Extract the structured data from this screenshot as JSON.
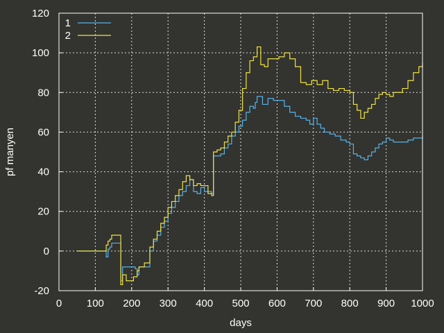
{
  "chart_data": {
    "type": "line",
    "title": "",
    "xlabel": "days",
    "ylabel": "pf manyen",
    "xlim": [
      0,
      1000
    ],
    "ylim": [
      -20,
      120
    ],
    "xticks": [
      0,
      100,
      200,
      300,
      400,
      500,
      600,
      700,
      800,
      900,
      1000
    ],
    "yticks": [
      -20,
      0,
      20,
      40,
      60,
      80,
      100,
      120
    ],
    "grid": true,
    "legend_position": "top-left",
    "background": "#333330",
    "series": [
      {
        "name": "1",
        "color": "#56b4e9",
        "step": true,
        "points": [
          [
            50,
            0
          ],
          [
            128,
            0
          ],
          [
            130,
            -3
          ],
          [
            135,
            1
          ],
          [
            140,
            2
          ],
          [
            145,
            4
          ],
          [
            160,
            4
          ],
          [
            170,
            -15
          ],
          [
            175,
            -8
          ],
          [
            200,
            -8
          ],
          [
            210,
            -9
          ],
          [
            215,
            -12
          ],
          [
            220,
            -8
          ],
          [
            240,
            -8
          ],
          [
            250,
            0
          ],
          [
            260,
            5
          ],
          [
            270,
            8
          ],
          [
            280,
            12
          ],
          [
            290,
            15
          ],
          [
            300,
            19
          ],
          [
            310,
            22
          ],
          [
            320,
            25
          ],
          [
            330,
            28
          ],
          [
            340,
            30
          ],
          [
            350,
            33
          ],
          [
            360,
            36
          ],
          [
            370,
            30
          ],
          [
            380,
            29
          ],
          [
            390,
            32
          ],
          [
            400,
            30
          ],
          [
            410,
            30
          ],
          [
            420,
            29
          ],
          [
            425,
            48
          ],
          [
            435,
            48
          ],
          [
            445,
            49
          ],
          [
            455,
            52
          ],
          [
            465,
            54
          ],
          [
            475,
            58
          ],
          [
            485,
            60
          ],
          [
            495,
            63
          ],
          [
            505,
            66
          ],
          [
            515,
            70
          ],
          [
            525,
            73
          ],
          [
            535,
            72
          ],
          [
            540,
            75
          ],
          [
            545,
            78
          ],
          [
            560,
            74
          ],
          [
            575,
            77
          ],
          [
            590,
            76
          ],
          [
            600,
            76
          ],
          [
            620,
            73
          ],
          [
            635,
            70
          ],
          [
            650,
            68
          ],
          [
            665,
            67
          ],
          [
            680,
            66
          ],
          [
            690,
            64
          ],
          [
            700,
            67
          ],
          [
            710,
            64
          ],
          [
            720,
            62
          ],
          [
            730,
            60
          ],
          [
            745,
            59
          ],
          [
            760,
            58
          ],
          [
            775,
            56
          ],
          [
            790,
            55
          ],
          [
            800,
            54
          ],
          [
            810,
            49
          ],
          [
            820,
            48
          ],
          [
            830,
            47
          ],
          [
            840,
            46
          ],
          [
            850,
            48
          ],
          [
            860,
            50
          ],
          [
            870,
            52
          ],
          [
            880,
            54
          ],
          [
            890,
            55
          ],
          [
            900,
            57
          ],
          [
            910,
            56
          ],
          [
            920,
            55
          ],
          [
            930,
            55
          ],
          [
            945,
            55
          ],
          [
            960,
            56
          ],
          [
            975,
            57
          ],
          [
            990,
            57
          ],
          [
            1000,
            58
          ]
        ]
      },
      {
        "name": "2",
        "color": "#f0e442",
        "step": true,
        "points": [
          [
            50,
            0
          ],
          [
            128,
            0
          ],
          [
            130,
            3
          ],
          [
            135,
            5
          ],
          [
            140,
            6
          ],
          [
            145,
            8
          ],
          [
            160,
            8
          ],
          [
            170,
            -17
          ],
          [
            175,
            -12
          ],
          [
            185,
            -15
          ],
          [
            195,
            -15
          ],
          [
            205,
            -13
          ],
          [
            215,
            -10
          ],
          [
            220,
            -8
          ],
          [
            235,
            -6
          ],
          [
            250,
            2
          ],
          [
            260,
            6
          ],
          [
            270,
            10
          ],
          [
            280,
            14
          ],
          [
            290,
            17
          ],
          [
            300,
            22
          ],
          [
            310,
            25
          ],
          [
            320,
            28
          ],
          [
            330,
            31
          ],
          [
            340,
            35
          ],
          [
            350,
            38
          ],
          [
            360,
            36
          ],
          [
            370,
            33
          ],
          [
            380,
            34
          ],
          [
            390,
            33
          ],
          [
            400,
            33
          ],
          [
            410,
            29
          ],
          [
            420,
            28
          ],
          [
            425,
            50
          ],
          [
            435,
            51
          ],
          [
            445,
            52
          ],
          [
            455,
            55
          ],
          [
            465,
            58
          ],
          [
            475,
            60
          ],
          [
            485,
            65
          ],
          [
            495,
            71
          ],
          [
            505,
            82
          ],
          [
            515,
            90
          ],
          [
            525,
            96
          ],
          [
            535,
            98
          ],
          [
            545,
            103
          ],
          [
            555,
            94
          ],
          [
            565,
            93
          ],
          [
            575,
            97
          ],
          [
            590,
            97
          ],
          [
            605,
            98
          ],
          [
            620,
            100
          ],
          [
            635,
            97
          ],
          [
            650,
            93
          ],
          [
            665,
            85
          ],
          [
            680,
            84
          ],
          [
            695,
            86
          ],
          [
            710,
            84
          ],
          [
            725,
            86
          ],
          [
            740,
            82
          ],
          [
            755,
            81
          ],
          [
            770,
            82
          ],
          [
            785,
            81
          ],
          [
            800,
            80
          ],
          [
            810,
            74
          ],
          [
            820,
            71
          ],
          [
            830,
            67
          ],
          [
            840,
            70
          ],
          [
            850,
            72
          ],
          [
            860,
            74
          ],
          [
            870,
            77
          ],
          [
            880,
            79
          ],
          [
            890,
            80
          ],
          [
            900,
            79
          ],
          [
            910,
            78
          ],
          [
            920,
            80
          ],
          [
            930,
            80
          ],
          [
            945,
            82
          ],
          [
            960,
            86
          ],
          [
            975,
            90
          ],
          [
            990,
            93
          ],
          [
            1000,
            95
          ]
        ]
      }
    ]
  }
}
